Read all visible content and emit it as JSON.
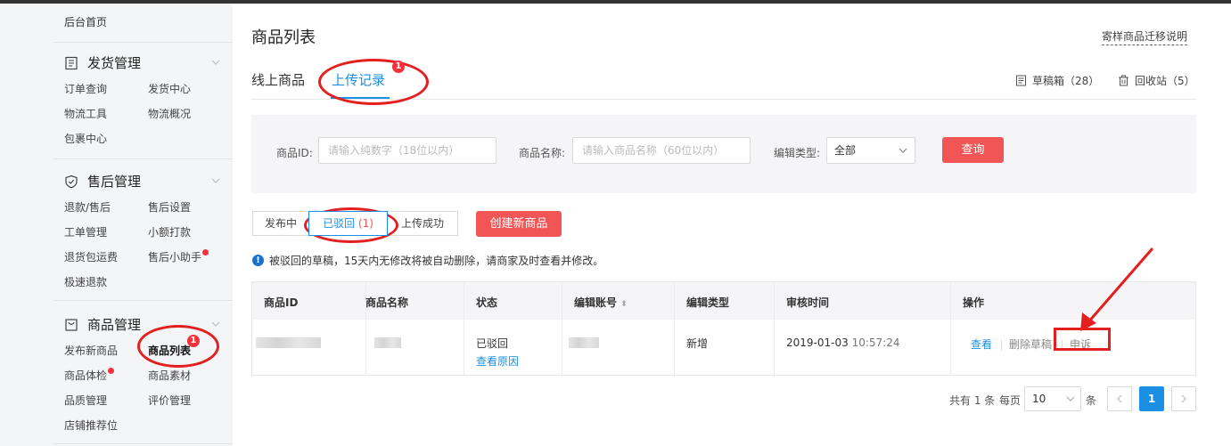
{
  "sidebar": {
    "home": "后台首页",
    "sections": [
      {
        "title": "发货管理",
        "items": [
          "订单查询",
          "发货中心",
          "物流工具",
          "物流概况",
          "包裹中心"
        ]
      },
      {
        "title": "售后管理",
        "items": [
          "退款/售后",
          "售后设置",
          "工单管理",
          "小额打款",
          "退货包运费",
          "售后小助手",
          "极速退款"
        ]
      },
      {
        "title": "商品管理",
        "items": [
          "发布新商品",
          "商品列表",
          "商品体检",
          "商品素材",
          "品质管理",
          "评价管理",
          "店铺推荐位"
        ]
      }
    ]
  },
  "header": {
    "title": "商品列表",
    "top_link": "寄样商品迁移说明",
    "tabs": [
      "线上商品",
      "上传记录"
    ],
    "draft_label": "草稿箱（28）",
    "recycle_label": "回收站（5）"
  },
  "filter": {
    "id_label": "商品ID:",
    "id_placeholder": "请输入纯数字（18位以内）",
    "name_label": "商品名称:",
    "name_placeholder": "请输入商品名称（60位以内）",
    "type_label": "编辑类型:",
    "type_value": "全部",
    "query_button": "查询"
  },
  "status_tabs": {
    "publishing": "发布中",
    "rejected": "已驳回",
    "rejected_count": "(1)",
    "success": "上传成功",
    "create_button": "创建新商品"
  },
  "notice": "被驳回的草稿，15天内无修改将被自动删除，请商家及时查看并修改。",
  "table": {
    "headers": [
      "商品ID",
      "商品名称",
      "状态",
      "编辑账号",
      "编辑类型",
      "审核时间",
      "操作"
    ],
    "row": {
      "status": "已驳回",
      "reason_link": "查看原因",
      "edit_type": "新增",
      "review_date": "2019-01-03",
      "review_time": "10:57:24",
      "ops": [
        "查看",
        "删除草稿",
        "申诉"
      ]
    }
  },
  "pagination": {
    "total": "共有 1 条",
    "per_page_label": "每页",
    "per_page_value": "10",
    "unit": "条",
    "current_page": "1"
  },
  "annotations": {
    "badge1": "1",
    "badge2": "1"
  },
  "colors": {
    "accent": "#1a8fe3",
    "danger": "#f25555",
    "annotation": "#e31f1f"
  }
}
